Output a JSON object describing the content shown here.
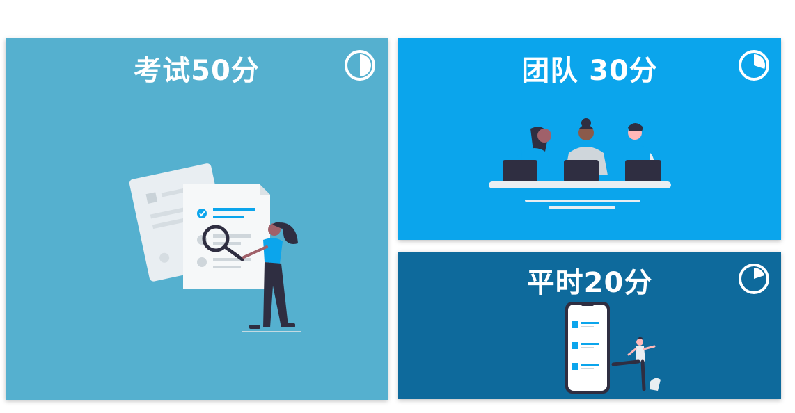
{
  "panels": {
    "exam": {
      "title": "考试50分",
      "weight_fraction": 0.5,
      "bg_color": "#55b0cf",
      "pie_icon": "half-pie-icon"
    },
    "team": {
      "title": "团队 30分",
      "weight_fraction": 0.3,
      "bg_color": "#0ba5ec",
      "pie_icon": "pie-chart-icon"
    },
    "daily": {
      "title": "平时20分",
      "weight_fraction": 0.2,
      "bg_color": "#0e6a9c",
      "pie_icon": "pie-chart-icon"
    }
  },
  "colors": {
    "accent": "#0ba5ec",
    "dark_figure": "#2f2e41",
    "white": "#ffffff"
  }
}
